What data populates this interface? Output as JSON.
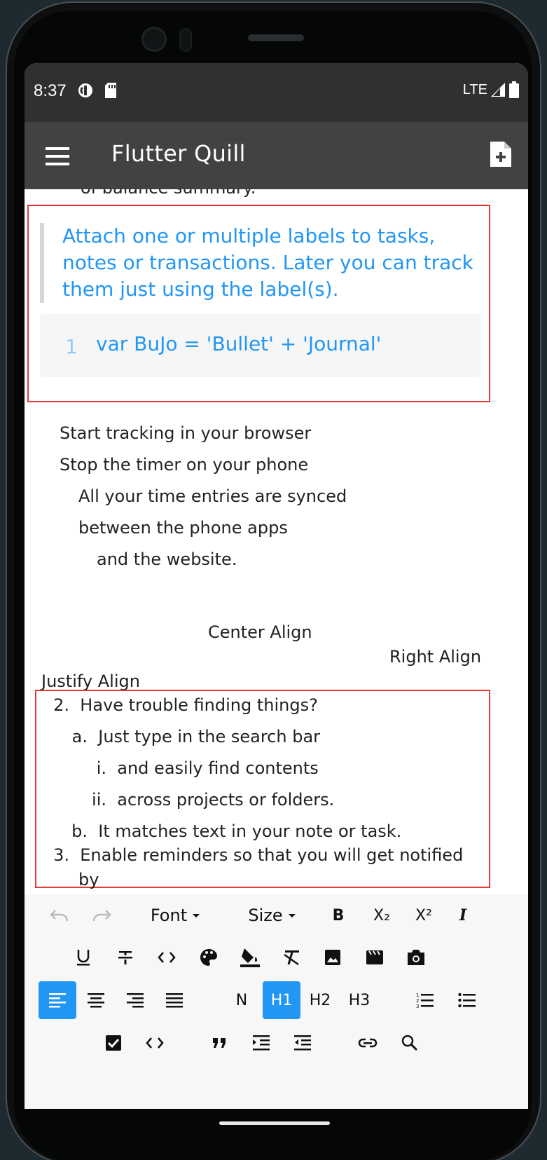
{
  "status_bar": {
    "time": "8:37",
    "network": "LTE",
    "icons": [
      "vpn-icon",
      "sd-card-icon",
      "signal-icon",
      "battery-icon"
    ]
  },
  "app_bar": {
    "title": "Flutter Quill",
    "menu_icon": "menu-icon",
    "action_icon": "note-add-icon"
  },
  "editor": {
    "cut_line": "of balance summary.",
    "quote": "Attach one or multiple labels to tasks, notes or transactions. Later you can track them just using the label(s).",
    "code": {
      "line_number": "1",
      "text": "var BuJo = 'Bullet' + 'Journal'"
    },
    "indent_lines": [
      "Start tracking in your browser",
      "Stop the timer on your phone",
      "All your time entries are synced",
      "between the phone apps",
      "and the website."
    ],
    "center_align": "Center Align",
    "right_align": "Right Align",
    "justify_align": "Justify Align",
    "list": [
      {
        "marker": "2.",
        "text": "Have trouble finding things?"
      },
      {
        "marker": "a.",
        "text": "Just type in the search bar"
      },
      {
        "marker": "i.",
        "text": "and easily find contents"
      },
      {
        "marker": "ii.",
        "text": "across projects or folders."
      },
      {
        "marker": "b.",
        "text": "It matches text in your note or task."
      },
      {
        "marker": "3.",
        "text": "Enable reminders so that you will get notified"
      },
      {
        "marker": "",
        "text": "by"
      }
    ],
    "selection_color": "#e53935",
    "accent_color": "#2196f3"
  },
  "toolbar": {
    "font_label": "Font",
    "size_label": "Size",
    "bold": "B",
    "subscript": "X₂",
    "superscript": "X²",
    "italic": "I",
    "normal": "N",
    "h1": "H1",
    "h2": "H2",
    "h3": "H3",
    "active": [
      "align-left",
      "h1"
    ]
  }
}
